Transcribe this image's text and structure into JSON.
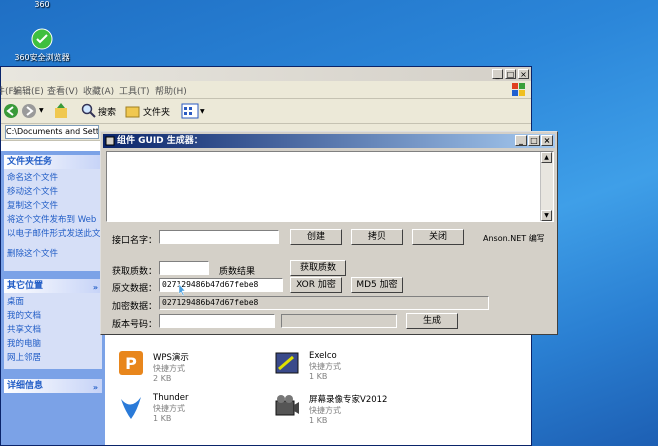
{
  "desktop": {
    "icons": [
      {
        "label": "360"
      },
      {
        "label": "360安全浏览器"
      }
    ]
  },
  "explorer": {
    "menu": [
      "文件(F)",
      "编辑(E)",
      "查看(V)",
      "收藏(A)",
      "工具(T)",
      "帮助(H)"
    ],
    "toolbar": {
      "search_label": "搜索",
      "folders_label": "文件夹"
    },
    "address": "C:\\Documents and Setti",
    "tasks_header": "文件夹任务",
    "tasks": [
      "命名这个文件",
      "移动这个文件",
      "复制这个文件",
      "将这个文件发布到 Web",
      "以电子邮件形式发送此文件",
      "删除这个文件"
    ],
    "other_header": "其它位置",
    "other_places": [
      "桌面",
      "我的文档",
      "共享文档",
      "我的电脑",
      "网上邻居"
    ],
    "details_header": "详细信息",
    "files": [
      {
        "name": "WPS演示",
        "type": "快捷方式",
        "size": "2 KB"
      },
      {
        "name": "ExeIco",
        "type": "快捷方式",
        "size": "1 KB"
      },
      {
        "name": "Thunder",
        "type": "快捷方式",
        "size": "1 KB"
      },
      {
        "name": "屏幕录像专家V2012",
        "type": "快捷方式",
        "size": "1 KB"
      }
    ]
  },
  "dialog": {
    "title": "组件 GUID 生成器：",
    "labels": {
      "interface_name": "接口名字：",
      "get_prime": "获取质数：",
      "prime_result": "质数结果",
      "original_data": "原文数据：",
      "encrypted_data": "加密数据：",
      "version": "版本号码："
    },
    "fields": {
      "interface_name": "",
      "prime": "",
      "original_data": "027129486b47d67febe8",
      "encrypted_data": "027129486b47d67febe8",
      "version": ""
    },
    "buttons": {
      "create": "创建",
      "copy": "拷贝",
      "close": "关闭",
      "get_prime": "获取质数",
      "xor_encrypt": "XOR 加密",
      "md5_encrypt": "MD5 加密",
      "generate": "生成"
    },
    "credit": "Anson.NET 编写"
  }
}
